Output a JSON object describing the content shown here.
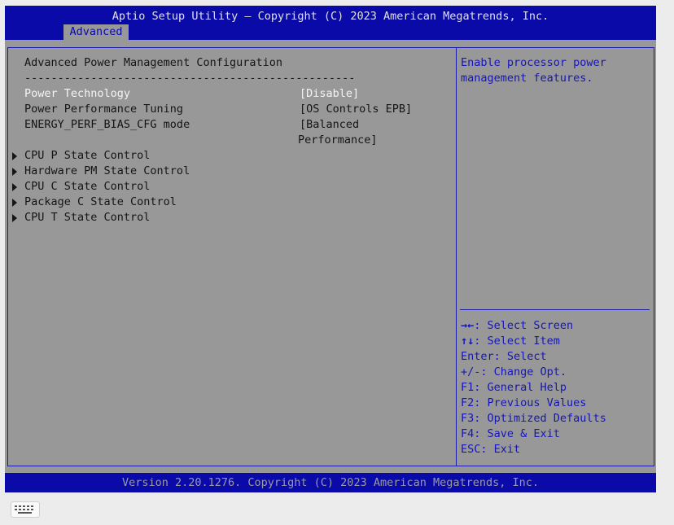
{
  "header": {
    "title": "Aptio Setup Utility – Copyright (C) 2023 American Megatrends, Inc.",
    "active_tab": "Advanced"
  },
  "main": {
    "heading": "Advanced Power Management Configuration",
    "separator": "--------------------------------------------------",
    "settings": [
      {
        "label": "Power Technology",
        "value": "[Disable]",
        "selected": true
      },
      {
        "label": "Power Performance Tuning",
        "value": "[OS Controls EPB]"
      },
      {
        "label": "ENERGY_PERF_BIAS_CFG mode",
        "value": "[Balanced",
        "value_line2": "Performance]"
      }
    ],
    "submenus": [
      "CPU P State Control",
      "Hardware PM State Control",
      "CPU C State Control",
      "Package C State Control",
      "CPU T State Control"
    ]
  },
  "help": {
    "line1": "Enable processor power",
    "line2": "management features."
  },
  "keys": [
    {
      "key": "→←",
      "desc": ": Select Screen"
    },
    {
      "key": "↑↓",
      "desc": ": Select Item"
    },
    {
      "key": "Enter",
      "desc": ": Select"
    },
    {
      "key": "+/-",
      "desc": ": Change Opt."
    },
    {
      "key": "F1",
      "desc": ": General Help"
    },
    {
      "key": "F2",
      "desc": ": Previous Values"
    },
    {
      "key": "F3",
      "desc": ": Optimized Defaults"
    },
    {
      "key": "F4",
      "desc": ": Save & Exit"
    },
    {
      "key": "ESC",
      "desc": ": Exit"
    }
  ],
  "footer": {
    "version": "Version 2.20.1276. Copyright (C) 2023 American Megatrends, Inc."
  },
  "icons": {
    "submenu": "triangle-right-icon",
    "keyboard": "keyboard-icon"
  },
  "colors": {
    "bar_blue": "#0a0aa8",
    "panel_gray": "#989898",
    "highlight_white": "#f4f4f4",
    "text_black": "#151515",
    "help_blue": "#1616b4"
  }
}
